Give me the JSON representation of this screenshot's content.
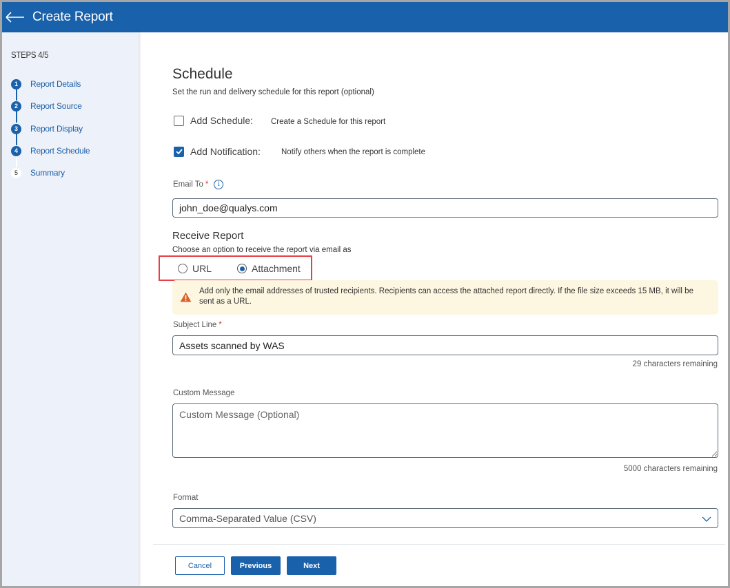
{
  "header": {
    "title": "Create Report"
  },
  "sidebar": {
    "steps_label": "STEPS 4/5",
    "steps": [
      {
        "number": "1",
        "label": "Report Details",
        "status": "done"
      },
      {
        "number": "2",
        "label": "Report Source",
        "status": "done"
      },
      {
        "number": "3",
        "label": "Report Display",
        "status": "done"
      },
      {
        "number": "4",
        "label": "Report Schedule",
        "status": "current"
      },
      {
        "number": "5",
        "label": "Summary",
        "status": "pending"
      }
    ]
  },
  "main": {
    "title": "Schedule",
    "subtitle": "Set the run and delivery schedule for this report (optional)",
    "add_schedule": {
      "label": "Add Schedule:",
      "description": "Create a Schedule for this report",
      "checked": false
    },
    "add_notification": {
      "label": "Add Notification:",
      "description": "Notify others when the report is complete",
      "checked": true
    },
    "email_to": {
      "label": "Email To",
      "required_mark": "*",
      "value": "john_doe@qualys.com"
    },
    "receive_report": {
      "title": "Receive Report",
      "subtitle": "Choose an option to receive the report via email as",
      "options": [
        {
          "label": "URL",
          "selected": false
        },
        {
          "label": "Attachment",
          "selected": true
        }
      ]
    },
    "warning": {
      "text": "Add only the email addresses of trusted recipients. Recipients can access the attached report directly. If the file size exceeds 15 MB, it will be sent as a URL.",
      "color": "#d9622b"
    },
    "subject_line": {
      "label": "Subject Line",
      "required_mark": "*",
      "value": "Assets scanned by WAS",
      "counter": "29 characters remaining"
    },
    "custom_message": {
      "label": "Custom Message",
      "placeholder": "Custom Message (Optional)",
      "value": "",
      "counter": "5000 characters remaining"
    },
    "format": {
      "label": "Format",
      "selected": "Comma-Separated Value (CSV)"
    }
  },
  "footer": {
    "cancel_label": "Cancel",
    "previous_label": "Previous",
    "next_label": "Next"
  },
  "colors": {
    "brand": "#1961ab",
    "highlight": "#e83e45",
    "warning_bg": "#fdf7e1"
  }
}
